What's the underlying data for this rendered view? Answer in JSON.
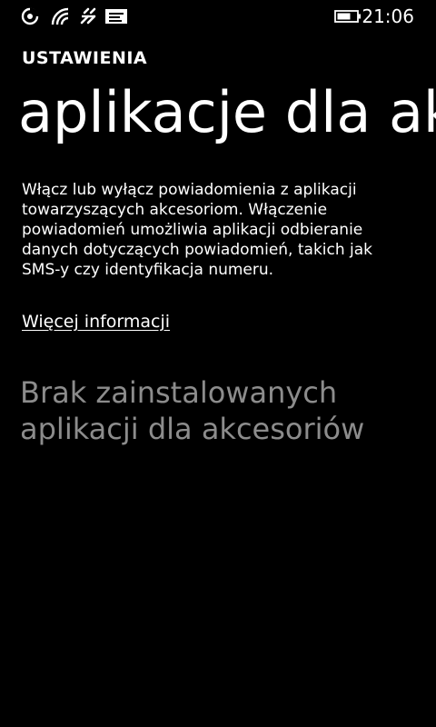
{
  "status_bar": {
    "time": "21:06",
    "icons": [
      "data-sense-icon",
      "wifi-signal-icon",
      "network-bars-icon",
      "notification-message-icon",
      "battery-icon"
    ]
  },
  "header": {
    "app_title": "USTAWIENIA",
    "page_title": "aplikacje dla akcesoriów"
  },
  "content": {
    "description": "Włącz lub wyłącz powiadomienia z aplikacji towarzyszących akcesoriom. Włączenie powiadomień umożliwia aplikacji odbieranie danych dotyczących powiadomień, takich jak SMS-y czy identyfikacja numeru.",
    "more_info_link": "Więcej informacji",
    "empty_message": "Brak zainstalowanych aplikacji dla akcesoriów"
  },
  "colors": {
    "background": "#000000",
    "text": "#ffffff",
    "muted_text": "#8c8c8c"
  }
}
